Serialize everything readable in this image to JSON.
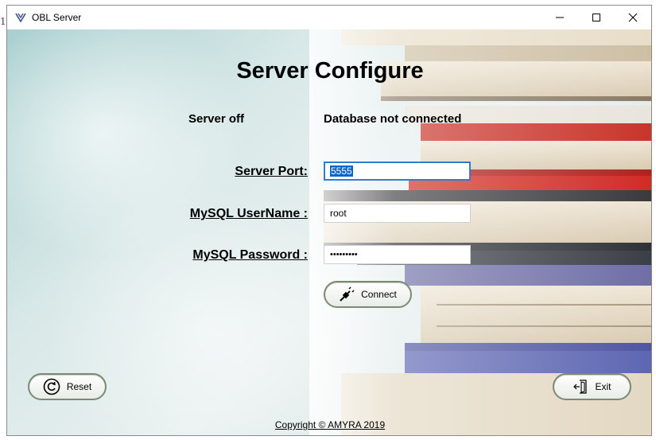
{
  "stray_char": "1",
  "window": {
    "title": "OBL Server",
    "controls": {
      "minimize_icon": "minimize-icon",
      "maximize_icon": "maximize-icon",
      "close_icon": "close-icon"
    }
  },
  "main": {
    "heading": "Server Configure",
    "status": {
      "server": "Server off",
      "database": "Database not connected"
    },
    "form": {
      "port_label": "Server Port:",
      "port_value": "5555",
      "username_label": "MySQL UserName :",
      "username_value": "root",
      "password_label": "MySQL Password :",
      "password_mask": "•••••••••"
    },
    "connect_label": "Connect",
    "reset_label": "Reset",
    "exit_label": "Exit",
    "copyright": "Copyright © AMYRA 2019"
  },
  "colors": {
    "focus_border": "#2f7cd3",
    "selection": "#0a66c9",
    "button_border": "#7a8a74"
  }
}
